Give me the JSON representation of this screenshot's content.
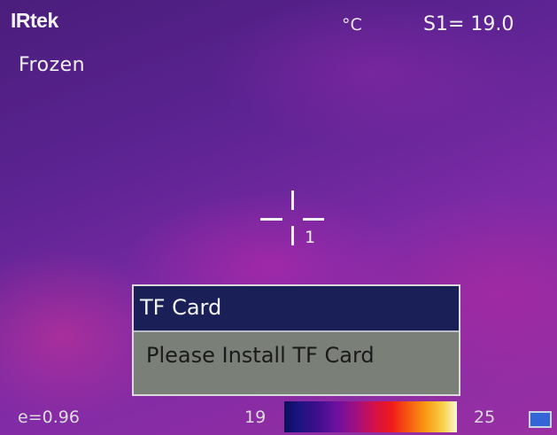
{
  "header": {
    "brand": "IRtek",
    "unit": "°C",
    "spot_reading": "S1= 19.0",
    "mode": "Frozen"
  },
  "crosshair": {
    "spot_label": "1"
  },
  "dialog": {
    "title": "TF Card",
    "message": "Please Install TF Card",
    "header_color": "#1a1f57",
    "body_color": "#7a7f78"
  },
  "footer": {
    "emissivity": "e=0.96",
    "scale_min": "19",
    "scale_max": "25",
    "palette": "iron",
    "battery_icon": "battery-icon"
  }
}
